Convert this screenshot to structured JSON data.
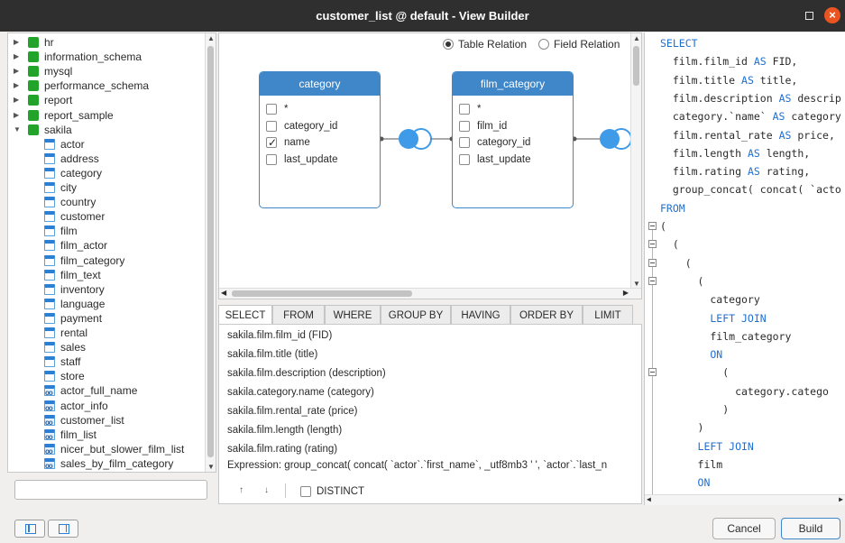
{
  "window": {
    "title": "customer_list @ default - View Builder"
  },
  "tree": {
    "databases": [
      {
        "label": "hr",
        "expanded": false
      },
      {
        "label": "information_schema",
        "expanded": false
      },
      {
        "label": "mysql",
        "expanded": false
      },
      {
        "label": "performance_schema",
        "expanded": false
      },
      {
        "label": "report",
        "expanded": false
      },
      {
        "label": "report_sample",
        "expanded": false
      },
      {
        "label": "sakila",
        "expanded": true
      }
    ],
    "tables": [
      "actor",
      "address",
      "category",
      "city",
      "country",
      "customer",
      "film",
      "film_actor",
      "film_category",
      "film_text",
      "inventory",
      "language",
      "payment",
      "rental",
      "sales",
      "staff",
      "store"
    ],
    "views": [
      "actor_full_name",
      "actor_info",
      "customer_list",
      "film_list",
      "nicer_but_slower_film_list",
      "sales_by_film_category"
    ]
  },
  "search": {
    "value": ""
  },
  "relation": {
    "options": [
      "Table Relation",
      "Field Relation"
    ],
    "selected": "Table Relation"
  },
  "entities": [
    {
      "name": "category",
      "fields": [
        {
          "label": "*",
          "checked": false
        },
        {
          "label": "category_id",
          "checked": false
        },
        {
          "label": "name",
          "checked": true
        },
        {
          "label": "last_update",
          "checked": false
        }
      ]
    },
    {
      "name": "film_category",
      "fields": [
        {
          "label": "*",
          "checked": false
        },
        {
          "label": "film_id",
          "checked": false
        },
        {
          "label": "category_id",
          "checked": false
        },
        {
          "label": "last_update",
          "checked": false
        }
      ]
    }
  ],
  "tabs": [
    "SELECT",
    "FROM",
    "WHERE",
    "GROUP BY",
    "HAVING",
    "ORDER BY",
    "LIMIT"
  ],
  "active_tab": "SELECT",
  "select_items": [
    "sakila.film.film_id   (FID)",
    "sakila.film.title   (title)",
    "sakila.film.description   (description)",
    "sakila.category.name   (category)",
    "sakila.film.rental_rate   (price)",
    "sakila.film.length   (length)",
    "sakila.film.rating   (rating)"
  ],
  "expression": {
    "label": "Expression:",
    "value": "group_concat( concat( `actor`.`first_name`, _utf8mb3 ' ', `actor`.`last_n"
  },
  "distinct": {
    "label": "DISTINCT",
    "checked": false
  },
  "sql_lines": [
    {
      "kw": "SELECT",
      "text": ""
    },
    {
      "kw": "",
      "text": "  film.film_id AS FID,"
    },
    {
      "kw": "",
      "text": "  film.title AS title,"
    },
    {
      "kw": "",
      "text": "  film.description AS descrip"
    },
    {
      "kw": "",
      "text": "  category.`name` AS category"
    },
    {
      "kw": "",
      "text": "  film.rental_rate AS price,"
    },
    {
      "kw": "",
      "text": "  film.length AS length,"
    },
    {
      "kw": "",
      "text": "  film.rating AS rating,"
    },
    {
      "kw": "",
      "text": "  group_concat( concat( `acto"
    },
    {
      "kw": "FROM",
      "text": ""
    },
    {
      "kw": "",
      "text": "("
    },
    {
      "kw": "",
      "text": "  ("
    },
    {
      "kw": "",
      "text": "    ("
    },
    {
      "kw": "",
      "text": "      ("
    },
    {
      "kw": "",
      "text": "        category"
    },
    {
      "kw": "",
      "text": "        LEFT JOIN"
    },
    {
      "kw": "",
      "text": "        film_category"
    },
    {
      "kw": "",
      "text": "        ON"
    },
    {
      "kw": "",
      "text": "          ("
    },
    {
      "kw": "",
      "text": "            category.catego"
    },
    {
      "kw": "",
      "text": "          )"
    },
    {
      "kw": "",
      "text": "      )"
    },
    {
      "kw": "",
      "text": "      LEFT JOIN"
    },
    {
      "kw": "",
      "text": "      film"
    },
    {
      "kw": "",
      "text": "      ON"
    }
  ],
  "buttons": {
    "cancel": "Cancel",
    "build": "Build"
  },
  "colors": {
    "accent": "#3f87c9",
    "keyword": "#1f6fd0",
    "db": "#22a32a",
    "close": "#e95420"
  }
}
